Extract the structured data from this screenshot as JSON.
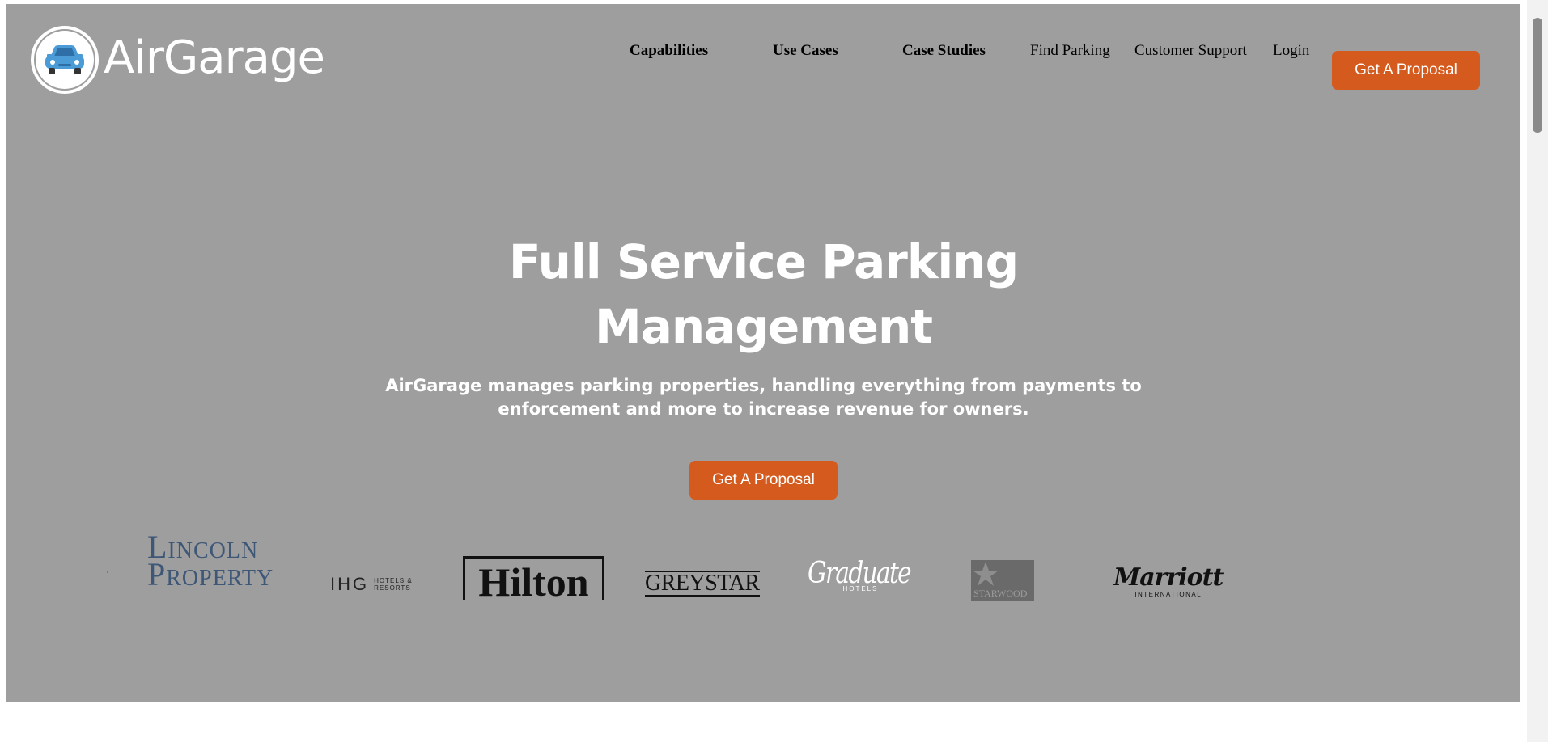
{
  "header": {
    "logo_text": "AirGarage",
    "nav": [
      {
        "label": "Capabilities"
      },
      {
        "label": "Use Cases"
      },
      {
        "label": "Case Studies"
      },
      {
        "label": "Find Parking"
      },
      {
        "label": "Customer Support"
      },
      {
        "label": "Login"
      }
    ],
    "cta_label": "Get A Proposal"
  },
  "hero": {
    "headline_line1": "Full Service Parking",
    "headline_line2": "Management",
    "subhead_line1": "AirGarage manages parking properties, handling everything from payments to",
    "subhead_line2": "enforcement and more to increase revenue for owners.",
    "cta_label": "Get A Proposal"
  },
  "partners": [
    {
      "line1": "Lincoln",
      "line2": "Property"
    },
    {
      "main": "IHG",
      "sub1": "HOTELS &",
      "sub2": "RESORTS"
    },
    {
      "name": "Hilton"
    },
    {
      "name": "GREYSTAR"
    },
    {
      "name": "Graduate",
      "sub": "HOTELS"
    },
    {
      "name": "STARWOOD"
    },
    {
      "name": "Marriott",
      "sub": "INTERNATIONAL"
    }
  ],
  "colors": {
    "hero_bg": "#9e9e9e",
    "accent": "#d45a1e",
    "text_light": "#ffffff"
  }
}
